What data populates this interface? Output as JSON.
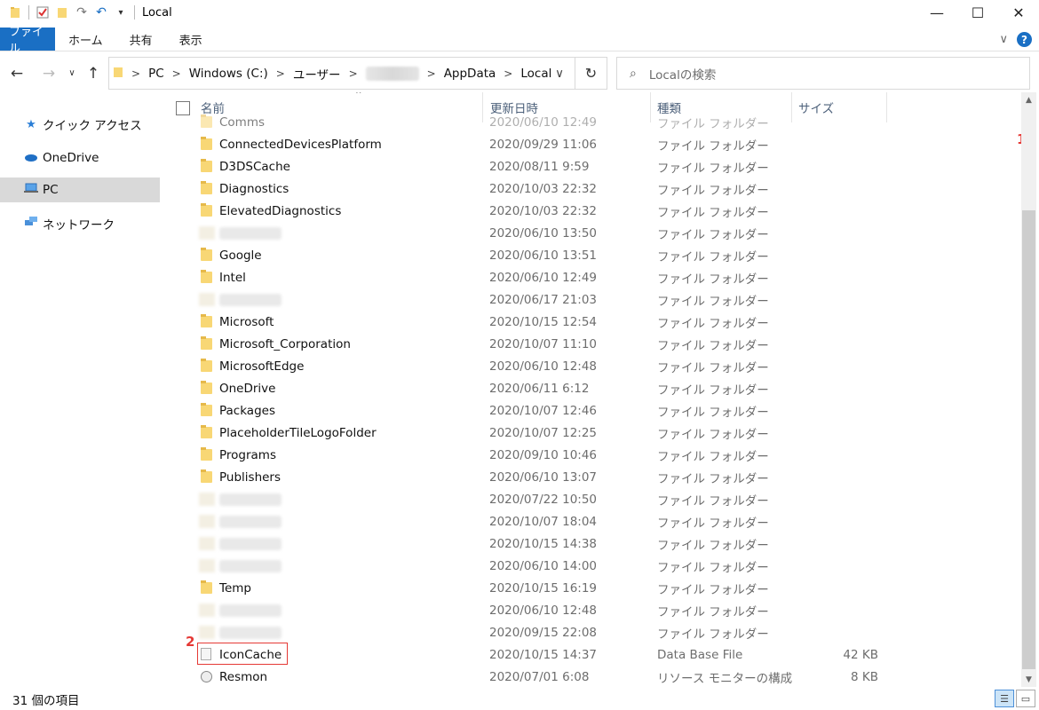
{
  "window": {
    "title": "Local",
    "minimize": "—",
    "maximize": "☐",
    "close": "✕"
  },
  "ribbon": {
    "tabs": [
      "ファイル",
      "ホーム",
      "共有",
      "表示"
    ],
    "expand": "∨",
    "help": "?"
  },
  "address": {
    "crumbs": [
      "PC",
      "Windows (C:)",
      "ユーザー",
      "AppData",
      "Local"
    ],
    "dropdown": "∨"
  },
  "search": {
    "placeholder": "Localの検索"
  },
  "nav": {
    "items": [
      {
        "label": "クイック アクセス",
        "icon": "star-icon"
      },
      {
        "label": "OneDrive",
        "icon": "cloud-icon"
      },
      {
        "label": "PC",
        "icon": "pc-icon"
      },
      {
        "label": "ネットワーク",
        "icon": "network-icon"
      }
    ]
  },
  "columns": {
    "name": "名前",
    "date": "更新日時",
    "type": "種類",
    "size": "サイズ"
  },
  "files": [
    {
      "name": "Comms",
      "date": "2020/06/10 12:49",
      "type": "ファイル フォルダー",
      "size": "",
      "kind": "folder",
      "blur": false,
      "partial": true
    },
    {
      "name": "ConnectedDevicesPlatform",
      "date": "2020/09/29 11:06",
      "type": "ファイル フォルダー",
      "size": "",
      "kind": "folder",
      "blur": false
    },
    {
      "name": "D3DSCache",
      "date": "2020/08/11 9:59",
      "type": "ファイル フォルダー",
      "size": "",
      "kind": "folder",
      "blur": false
    },
    {
      "name": "Diagnostics",
      "date": "2020/10/03 22:32",
      "type": "ファイル フォルダー",
      "size": "",
      "kind": "folder",
      "blur": false
    },
    {
      "name": "ElevatedDiagnostics",
      "date": "2020/10/03 22:32",
      "type": "ファイル フォルダー",
      "size": "",
      "kind": "folder",
      "blur": false
    },
    {
      "name": "",
      "date": "2020/06/10 13:50",
      "type": "ファイル フォルダー",
      "size": "",
      "kind": "folder",
      "blur": true
    },
    {
      "name": "Google",
      "date": "2020/06/10 13:51",
      "type": "ファイル フォルダー",
      "size": "",
      "kind": "folder",
      "blur": false
    },
    {
      "name": "Intel",
      "date": "2020/06/10 12:49",
      "type": "ファイル フォルダー",
      "size": "",
      "kind": "folder",
      "blur": false
    },
    {
      "name": "",
      "date": "2020/06/17 21:03",
      "type": "ファイル フォルダー",
      "size": "",
      "kind": "folder",
      "blur": true
    },
    {
      "name": "Microsoft",
      "date": "2020/10/15 12:54",
      "type": "ファイル フォルダー",
      "size": "",
      "kind": "folder",
      "blur": false
    },
    {
      "name": "Microsoft_Corporation",
      "date": "2020/10/07 11:10",
      "type": "ファイル フォルダー",
      "size": "",
      "kind": "folder",
      "blur": false
    },
    {
      "name": "MicrosoftEdge",
      "date": "2020/06/10 12:48",
      "type": "ファイル フォルダー",
      "size": "",
      "kind": "folder",
      "blur": false
    },
    {
      "name": "OneDrive",
      "date": "2020/06/11 6:12",
      "type": "ファイル フォルダー",
      "size": "",
      "kind": "folder",
      "blur": false
    },
    {
      "name": "Packages",
      "date": "2020/10/07 12:46",
      "type": "ファイル フォルダー",
      "size": "",
      "kind": "folder",
      "blur": false
    },
    {
      "name": "PlaceholderTileLogoFolder",
      "date": "2020/10/07 12:25",
      "type": "ファイル フォルダー",
      "size": "",
      "kind": "folder",
      "blur": false
    },
    {
      "name": "Programs",
      "date": "2020/09/10 10:46",
      "type": "ファイル フォルダー",
      "size": "",
      "kind": "folder",
      "blur": false
    },
    {
      "name": "Publishers",
      "date": "2020/06/10 13:07",
      "type": "ファイル フォルダー",
      "size": "",
      "kind": "folder",
      "blur": false
    },
    {
      "name": "",
      "date": "2020/07/22 10:50",
      "type": "ファイル フォルダー",
      "size": "",
      "kind": "folder",
      "blur": true
    },
    {
      "name": "",
      "date": "2020/10/07 18:04",
      "type": "ファイル フォルダー",
      "size": "",
      "kind": "folder",
      "blur": true
    },
    {
      "name": "",
      "date": "2020/10/15 14:38",
      "type": "ファイル フォルダー",
      "size": "",
      "kind": "folder",
      "blur": true
    },
    {
      "name": "",
      "date": "2020/06/10 14:00",
      "type": "ファイル フォルダー",
      "size": "",
      "kind": "folder",
      "blur": true
    },
    {
      "name": "Temp",
      "date": "2020/10/15 16:19",
      "type": "ファイル フォルダー",
      "size": "",
      "kind": "folder",
      "blur": false
    },
    {
      "name": "",
      "date": "2020/06/10 12:48",
      "type": "ファイル フォルダー",
      "size": "",
      "kind": "folder",
      "blur": true
    },
    {
      "name": "",
      "date": "2020/09/15 22:08",
      "type": "ファイル フォルダー",
      "size": "",
      "kind": "folder",
      "blur": true
    },
    {
      "name": "IconCache",
      "date": "2020/10/15 14:37",
      "type": "Data Base File",
      "size": "42 KB",
      "kind": "file",
      "blur": false,
      "highlight": true
    },
    {
      "name": "Resmon",
      "date": "2020/07/01 6:08",
      "type": "リソース モニターの構成",
      "size": "8 KB",
      "kind": "res",
      "blur": false
    }
  ],
  "annotations": {
    "step1": "1",
    "step2": "2"
  },
  "status": {
    "count": "31 個の項目"
  },
  "accent": "#1a6fc4",
  "annotation_color": "#e53935"
}
